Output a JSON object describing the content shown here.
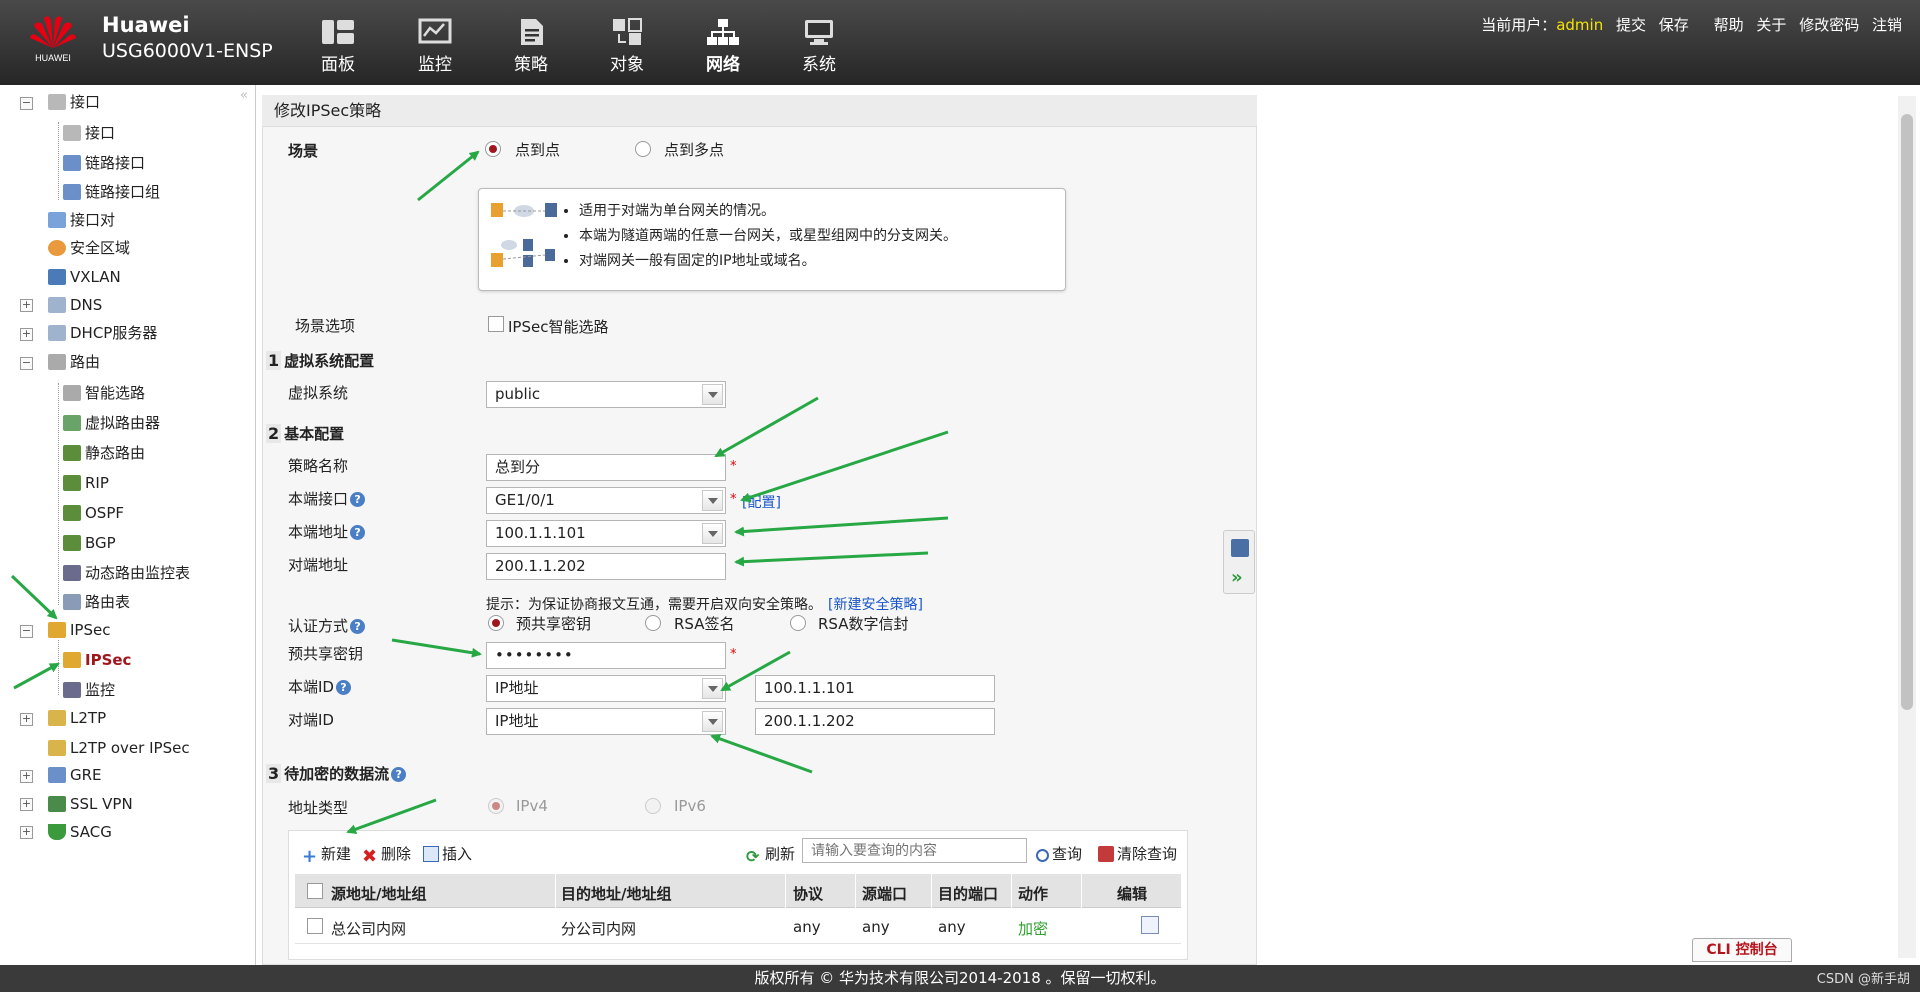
{
  "header": {
    "brand_logo_text": "HUAWEI",
    "brand_name": "Huawei",
    "model": "USG6000V1-ENSP",
    "nav": [
      {
        "label": "面板",
        "icon": "dashboard-icon"
      },
      {
        "label": "监控",
        "icon": "monitor-icon"
      },
      {
        "label": "策略",
        "icon": "policy-icon"
      },
      {
        "label": "对象",
        "icon": "object-icon"
      },
      {
        "label": "网络",
        "icon": "network-icon"
      },
      {
        "label": "系统",
        "icon": "system-icon"
      }
    ],
    "current_user_label": "当前用户：",
    "current_user": "admin",
    "links": [
      "提交",
      "保存",
      "帮助",
      "关于",
      "修改密码",
      "注销"
    ]
  },
  "sidebar": {
    "collapse_glyph": "«",
    "items": [
      {
        "label": "接口",
        "level": 0,
        "expander": "minus"
      },
      {
        "label": "接口",
        "level": 1
      },
      {
        "label": "链路接口",
        "level": 1
      },
      {
        "label": "链路接口组",
        "level": 1
      },
      {
        "label": "接口对",
        "level": 0
      },
      {
        "label": "安全区域",
        "level": 0
      },
      {
        "label": "VXLAN",
        "level": 0
      },
      {
        "label": "DNS",
        "level": 0,
        "expander": "plus"
      },
      {
        "label": "DHCP服务器",
        "level": 0,
        "expander": "plus"
      },
      {
        "label": "路由",
        "level": 0,
        "expander": "minus"
      },
      {
        "label": "智能选路",
        "level": 1
      },
      {
        "label": "虚拟路由器",
        "level": 1
      },
      {
        "label": "静态路由",
        "level": 1
      },
      {
        "label": "RIP",
        "level": 1
      },
      {
        "label": "OSPF",
        "level": 1
      },
      {
        "label": "BGP",
        "level": 1
      },
      {
        "label": "动态路由监控表",
        "level": 1
      },
      {
        "label": "路由表",
        "level": 1
      },
      {
        "label": "IPSec",
        "level": 0,
        "expander": "minus"
      },
      {
        "label": "IPSec",
        "level": 1,
        "selected": true
      },
      {
        "label": "监控",
        "level": 1
      },
      {
        "label": "L2TP",
        "level": 0,
        "expander": "plus"
      },
      {
        "label": "L2TP over IPSec",
        "level": 0
      },
      {
        "label": "GRE",
        "level": 0,
        "expander": "plus"
      },
      {
        "label": "SSL VPN",
        "level": 0,
        "expander": "plus"
      },
      {
        "label": "SACG",
        "level": 0,
        "expander": "plus"
      }
    ]
  },
  "form": {
    "title": "修改IPSec策略",
    "scene_label": "场景",
    "scene_options": [
      "点到点",
      "点到多点"
    ],
    "scene_tips": [
      "适用于对端为单台网关的情况。",
      "本端为隧道两端的任意一台网关，或星型组网中的分支网关。",
      "对端网关一般有固定的IP地址或域名。"
    ],
    "scene_option_label": "场景选项",
    "smart_route_label": "IPSec智能选路",
    "sec1_num": "1",
    "sec1_title": "虚拟系统配置",
    "vsys_label": "虚拟系统",
    "vsys_value": "public",
    "sec2_num": "2",
    "sec2_title": "基本配置",
    "policy_name_label": "策略名称",
    "policy_name_value": "总到分",
    "local_iface_label": "本端接口",
    "local_iface_value": "GE1/0/1",
    "config_link": "[配置]",
    "local_addr_label": "本端地址",
    "local_addr_value": "100.1.1.101",
    "peer_addr_label": "对端地址",
    "peer_addr_value": "200.1.1.202",
    "hint_text": "提示：为保证协商报文互通，需要开启双向安全策略。",
    "new_policy_link": "[新建安全策略]",
    "auth_label": "认证方式",
    "auth_options": [
      "预共享密钥",
      "RSA签名",
      "RSA数字信封"
    ],
    "psk_label": "预共享密钥",
    "psk_value": "••••••••",
    "local_id_label": "本端ID",
    "local_id_type": "IP地址",
    "local_id_value": "100.1.1.101",
    "peer_id_label": "对端ID",
    "peer_id_type": "IP地址",
    "peer_id_value": "200.1.1.202",
    "required_mark": "*",
    "help_glyph": "?",
    "sec3_num": "3",
    "sec3_title": "待加密的数据流",
    "addr_type_label": "地址类型",
    "addr_type_options": [
      "IPv4",
      "IPv6"
    ]
  },
  "table": {
    "toolbar": {
      "new": "新建",
      "delete": "删除",
      "insert": "插入",
      "refresh": "刷新",
      "search_placeholder": "请输入要查询的内容",
      "query": "查询",
      "clear": "清除查询"
    },
    "columns": [
      "源地址/地址组",
      "目的地址/地址组",
      "协议",
      "源端口",
      "目的端口",
      "动作",
      "编辑"
    ],
    "rows": [
      {
        "src": "总公司内网",
        "dst": "分公司内网",
        "proto": "any",
        "sport": "any",
        "dport": "any",
        "action": "加密"
      }
    ]
  },
  "cli_button": "CLI 控制台",
  "footer": "版权所有 © 华为技术有限公司2014-2018 。保留一切权利。",
  "watermark": "CSDN @新手胡",
  "colors": {
    "accent_red": "#a0161c",
    "link_blue": "#1a56c9",
    "user_yellow": "#f5e400",
    "arrow_green": "#27a844",
    "action_green": "#2ca02c"
  }
}
